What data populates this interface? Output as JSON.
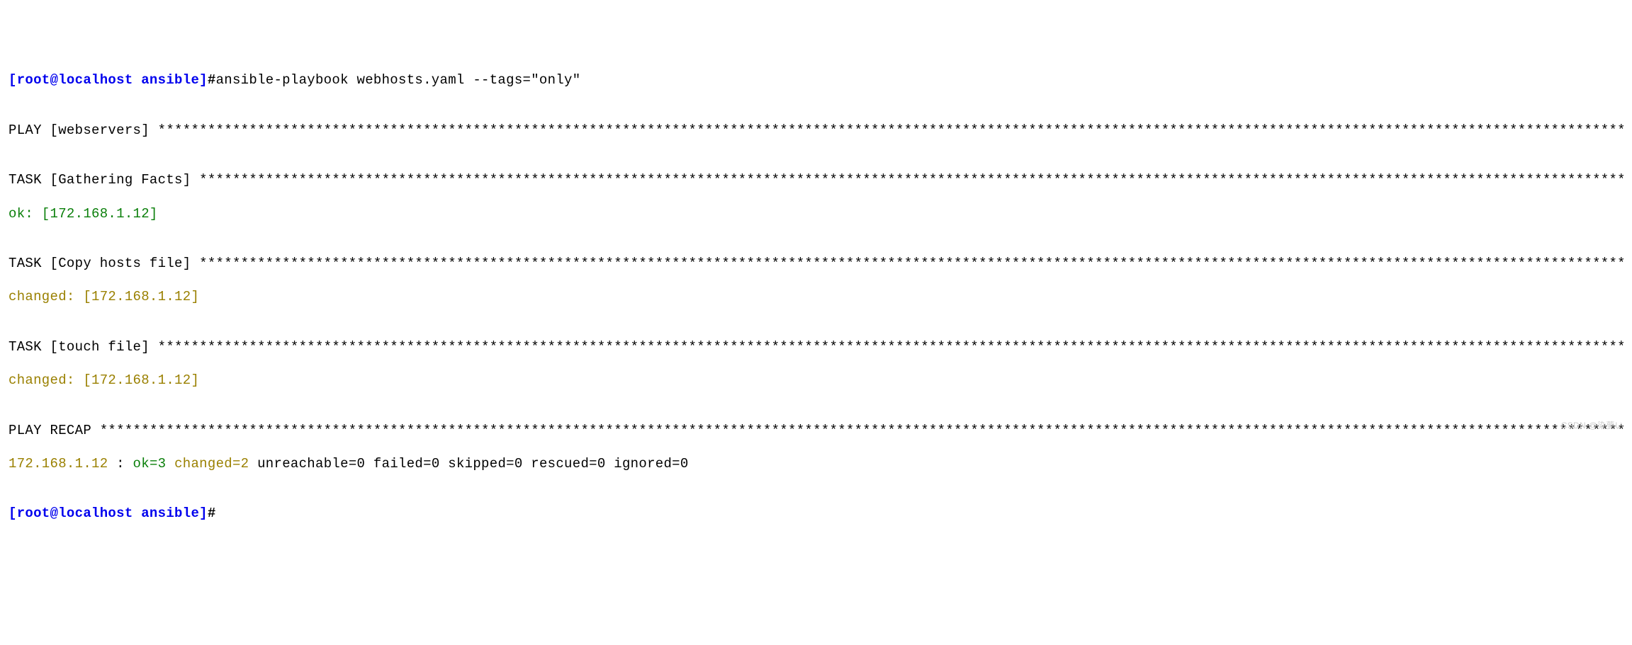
{
  "prompt1": {
    "user_host": "[root@localhost ansible]",
    "hash": "#",
    "command": "ansible-playbook webhosts.yaml --tags=\"only\""
  },
  "play": {
    "label": "PLAY [webservers] ",
    "stars": "*********************************************************************************************************************************************************************************************************************************"
  },
  "task1": {
    "label": "TASK [Gathering Facts] ",
    "stars": "****************************************************************************************************************************************************************************************************************************",
    "result": "ok: [172.168.1.12]"
  },
  "task2": {
    "label": "TASK [Copy hosts file] ",
    "stars": "****************************************************************************************************************************************************************************************************************************",
    "result": "changed: [172.168.1.12]"
  },
  "task3": {
    "label": "TASK [touch file] ",
    "stars": "*********************************************************************************************************************************************************************************************************************************",
    "result": "changed: [172.168.1.12]"
  },
  "recap": {
    "label": "PLAY RECAP ",
    "stars": "****************************************************************************************************************************************************************************************************************************************",
    "host": "172.168.1.12",
    "spacer1": "               : ",
    "ok": "ok=3",
    "spacer2": "    ",
    "changed": "changed=2",
    "spacer3": "    ",
    "rest": "unreachable=0    failed=0    skipped=0    rescued=0    ignored=0"
  },
  "prompt2": {
    "user_host": "[root@localhost ansible]",
    "hash": "#"
  },
  "watermark": "CSDN @染夢い"
}
